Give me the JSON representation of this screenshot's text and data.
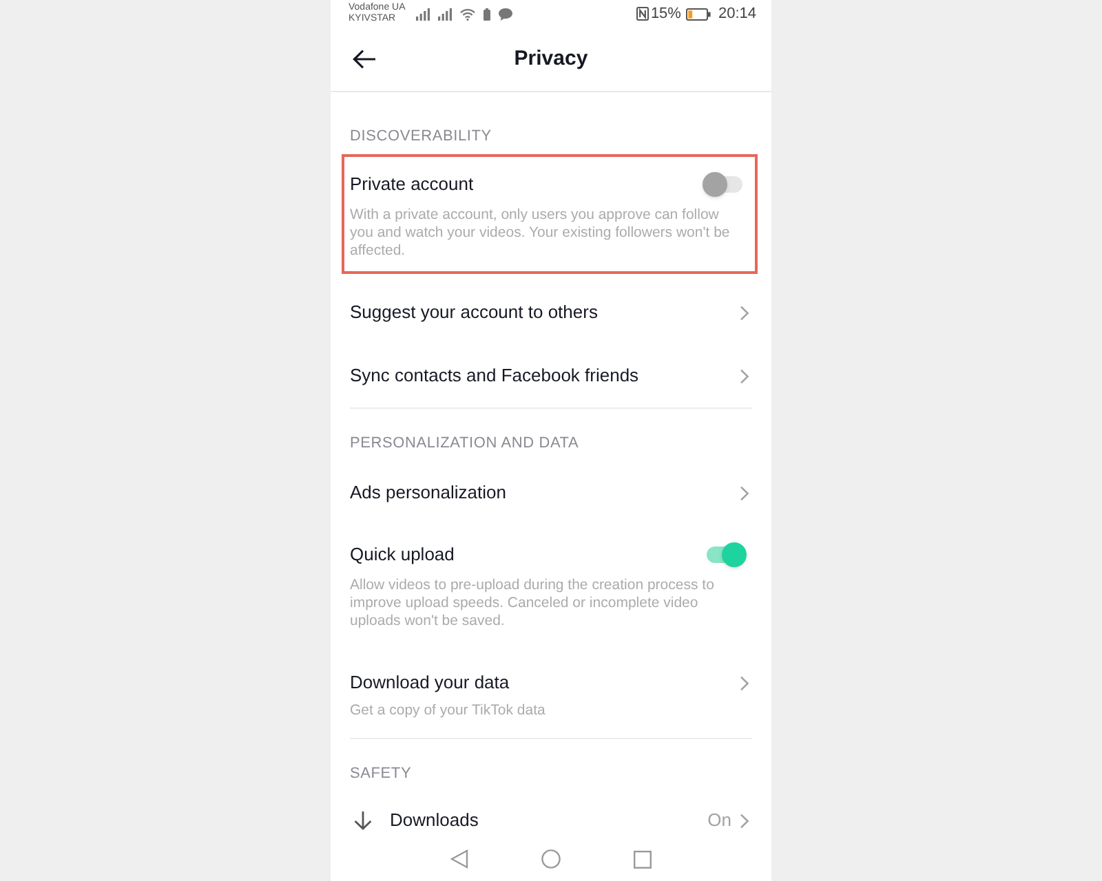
{
  "status_bar": {
    "carriers": [
      "Vodafone UA",
      "KYIVSTAR"
    ],
    "battery_percent": "15%",
    "time": "20:14"
  },
  "header": {
    "title": "Privacy"
  },
  "sections": [
    {
      "title": "DISCOVERABILITY",
      "items": [
        {
          "kind": "toggle",
          "label": "Private account",
          "description": "With a private account, only users you approve can follow you and watch your videos. Your existing followers won't be affected.",
          "on": false,
          "highlighted": true
        },
        {
          "kind": "link",
          "label": "Suggest your account to others",
          "highlighted": false
        },
        {
          "kind": "link",
          "label": "Sync contacts and Facebook friends",
          "highlighted": false
        }
      ]
    },
    {
      "title": "PERSONALIZATION AND DATA",
      "items": [
        {
          "kind": "link",
          "label": "Ads personalization",
          "highlighted": false
        },
        {
          "kind": "toggle",
          "label": "Quick upload",
          "description": "Allow videos to pre-upload during the creation process to improve upload speeds. Canceled or incomplete video uploads won't be saved.",
          "on": true,
          "highlighted": false
        },
        {
          "kind": "link",
          "label": "Download your data",
          "description": "Get a copy of your TikTok data",
          "highlighted": false
        }
      ]
    },
    {
      "title": "SAFETY",
      "items": [
        {
          "kind": "icon_link",
          "label": "Downloads",
          "value": "On",
          "highlighted": false
        }
      ]
    }
  ]
}
